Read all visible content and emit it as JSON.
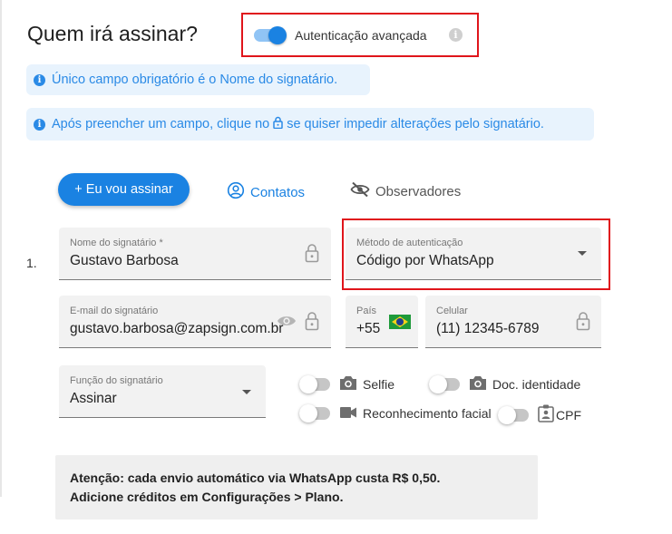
{
  "header": {
    "title": "Quem irá assinar?",
    "advanced_auth_label": "Autenticação avançada",
    "advanced_auth_on": true
  },
  "banners": {
    "required_msg": "Único campo obrigatório é o Nome do signatário.",
    "lock_msg_before": "Após preencher um campo, clique no",
    "lock_msg_after": "se quiser impedir alterações pelo signatário."
  },
  "actions": {
    "self_sign": "+ Eu vou assinar",
    "contacts": "Contatos",
    "observers": "Observadores"
  },
  "signer": {
    "number": "1.",
    "name_label": "Nome do signatário *",
    "name_value": "Gustavo Barbosa",
    "auth_method_label": "Método de autenticação",
    "auth_method_value": "Código por WhatsApp",
    "email_label": "E-mail do signatário",
    "email_value": "gustavo.barbosa@zapsign.com.br",
    "country_label": "País",
    "country_code": "+55",
    "phone_label": "Celular",
    "phone_value": "(11) 12345-6789",
    "role_label": "Função do signatário",
    "role_value": "Assinar"
  },
  "options": {
    "selfie": "Selfie",
    "id_doc": "Doc. identidade",
    "facial": "Reconhecimento facial",
    "cpf": "CPF"
  },
  "notice": {
    "line1": "Atenção: cada envio automático via WhatsApp custa R$ 0,50.",
    "line2": "Adicione créditos em Configurações > Plano."
  },
  "colors": {
    "accent": "#1a82e2",
    "highlight_border": "#e0151b",
    "banner_bg": "#e8f3fd"
  }
}
